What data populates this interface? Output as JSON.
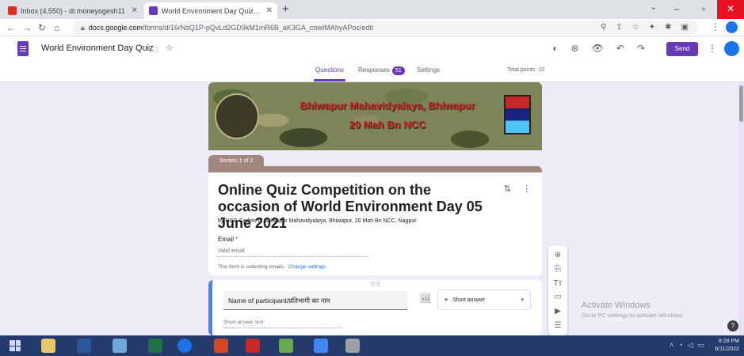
{
  "browser": {
    "tabs": [
      {
        "title": "Inbox (4,550) - dr.moneyogesh11",
        "favicon_color": "#d93025"
      },
      {
        "title": "World Environment Day Quiz - G",
        "favicon_color": "#673ab7"
      }
    ],
    "new_tab": "+",
    "address": {
      "domain": "docs.google.com",
      "path": "/forms/d/16rNsQ1P-pQvLd2GD9kM1mR6B_aK3GA_cnwIMAhyAPoc/edit"
    }
  },
  "forms_header": {
    "doc_title": "World Environment Day Quiz",
    "send_label": "Send",
    "tabs": [
      {
        "label": "Questions"
      },
      {
        "label": "Responses",
        "badge": "51"
      },
      {
        "label": "Settings"
      }
    ],
    "total_points": "Total points: 10"
  },
  "banner": {
    "line1": "Bhiwapur Mahavidyalaya, Bhiwapur",
    "line2": "20 Mah Bn NCC"
  },
  "section_tag": "Section 1 of 2",
  "title_card": {
    "title": "Online Quiz Competition on the occasion of World Environment Day 05 June 2021",
    "description": "by NCC Cadets of Bhiwapur Mahavidyalaya, Bhiwapur, 20 Mah Bn NCC, Nagpur",
    "email_label": "Email",
    "email_required": "*",
    "email_placeholder": "Valid email",
    "collecting_text": "This form is collecting emails.",
    "change_settings": "Change settings"
  },
  "question_card": {
    "title": "Name of participant/प्रतिभागी का नाम",
    "type_label": "Short answer",
    "answer_placeholder": "Short answer text"
  },
  "watermark": {
    "line1": "Activate Windows",
    "line2": "Go to PC settings to activate Windows."
  },
  "help_glyph": "?",
  "taskbar": {
    "clock_time": "8:28 PM",
    "clock_date": "6/11/2022",
    "app_colors": [
      "#e8c76a",
      "#2b579a",
      "#6fa8dc",
      "#217346",
      "#1a73e8",
      "#d24726",
      "#c62828",
      "#6aa84f",
      "#4285f4",
      "#9aa0a6"
    ]
  }
}
